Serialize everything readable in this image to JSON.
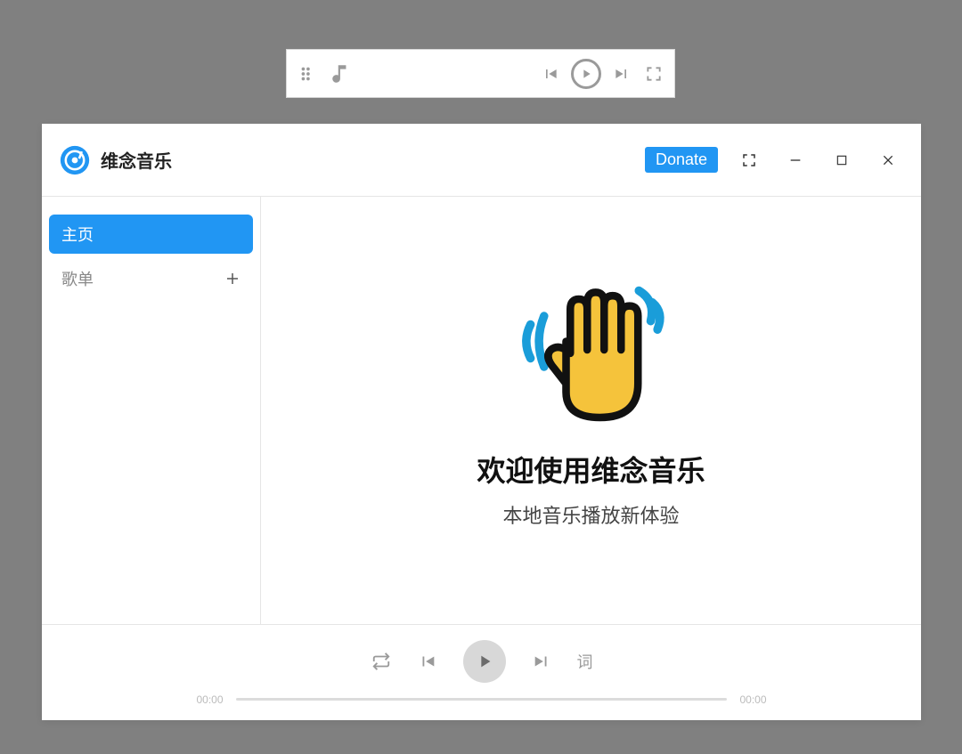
{
  "mini_player": {
    "icons": {
      "grip": "grip-icon",
      "music": "music-note-icon",
      "prev": "previous-track-icon",
      "play": "play-icon",
      "next": "next-track-icon",
      "expand": "expand-icon"
    }
  },
  "titlebar": {
    "app_title": "维念音乐",
    "donate_label": "Donate",
    "icons": {
      "compact": "compact-mode-icon",
      "minimize": "minimize-icon",
      "maximize": "maximize-icon",
      "close": "close-icon"
    }
  },
  "sidebar": {
    "items": [
      {
        "label": "主页",
        "active": true
      },
      {
        "label": "歌单",
        "has_add": true
      }
    ]
  },
  "main": {
    "welcome_title": "欢迎使用维念音乐",
    "welcome_subtitle": "本地音乐播放新体验",
    "hand_icon": "waving-hand-icon"
  },
  "player": {
    "icons": {
      "repeat": "repeat-icon",
      "prev": "previous-track-icon",
      "play": "play-icon",
      "next": "next-track-icon"
    },
    "lyric_label": "词",
    "time_current": "00:00",
    "time_total": "00:00"
  },
  "colors": {
    "accent": "#2196f3",
    "muted": "#9a9a9a"
  }
}
